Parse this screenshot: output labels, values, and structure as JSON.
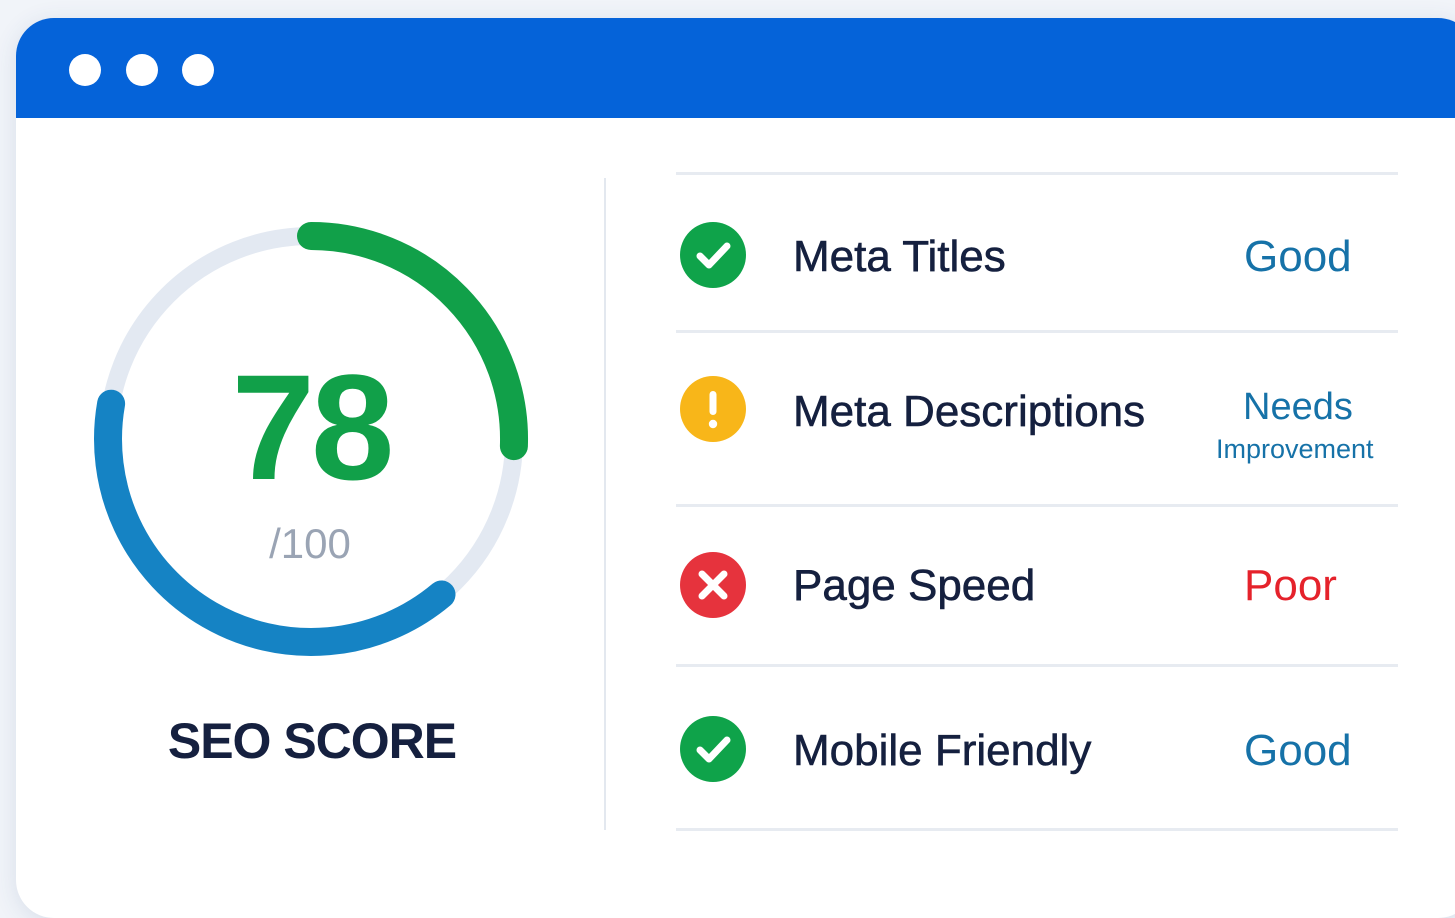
{
  "window": {
    "title_bar_color": "#0563d9",
    "controls": [
      "dot",
      "dot",
      "dot"
    ]
  },
  "score": {
    "value": "78",
    "max_label": "/100",
    "label": "SEO SCORE",
    "fraction": 0.78,
    "colors": {
      "good_arc": "#11a049",
      "blue_arc": "#1583c4",
      "track": "#e3e9f2"
    }
  },
  "checks": [
    {
      "name": "Meta Titles",
      "status": "Good",
      "level": "good",
      "icon": "check-circle-icon"
    },
    {
      "name": "Meta Descriptions",
      "status_line1": "Needs",
      "status_line2": "Improvement",
      "level": "warn",
      "icon": "exclamation-circle-icon"
    },
    {
      "name": "Page Speed",
      "status": "Poor",
      "level": "poor",
      "icon": "x-circle-icon"
    },
    {
      "name": "Mobile Friendly",
      "status": "Good",
      "level": "good",
      "icon": "check-circle-icon"
    }
  ],
  "colors": {
    "good": "#0fa34a",
    "warn": "#f8b619",
    "poor": "#e6333d",
    "status_text": "#1672a8",
    "poor_text": "#e5222b"
  }
}
